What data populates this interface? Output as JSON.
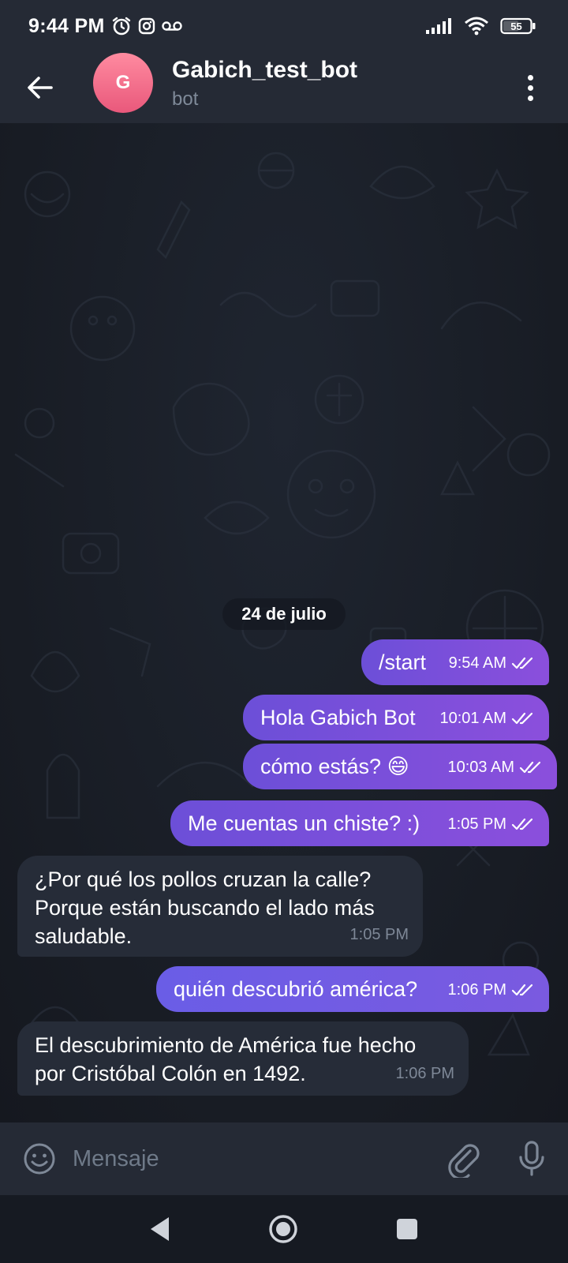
{
  "status_bar": {
    "time": "9:44 PM",
    "battery": "55",
    "icons": [
      "alarm-icon",
      "instagram-icon",
      "voicemail-icon",
      "signal-icon",
      "wifi-icon",
      "battery-icon"
    ]
  },
  "header": {
    "avatar_letter": "G",
    "title": "Gabich_test_bot",
    "subtitle": "bot",
    "back_icon": "arrow-left-icon",
    "menu_icon": "more-vertical-icon",
    "avatar_color": "#ef6a8a"
  },
  "chat": {
    "date_label": "24 de julio",
    "messages": [
      {
        "direction": "out",
        "text": "/start",
        "time": "9:54 AM"
      },
      {
        "direction": "out",
        "text": "Hola Gabich Bot",
        "time": "10:01 AM"
      },
      {
        "direction": "out",
        "text": "cómo estás? 😄",
        "time": "10:03 AM"
      },
      {
        "direction": "out",
        "text": "Me cuentas un chiste? :)",
        "time": "1:05 PM"
      },
      {
        "direction": "in",
        "lines": [
          "¿Por qué los pollos cruzan la calle?",
          "Porque están buscando el lado más",
          "saludable."
        ],
        "time": "1:05 PM"
      },
      {
        "direction": "out",
        "text": "quién descubrió américa?",
        "time": "1:06 PM"
      },
      {
        "direction": "in",
        "lines": [
          "El descubrimiento de América fue hecho",
          "por Cristóbal Colón en 1492."
        ],
        "time": "1:06 PM"
      }
    ]
  },
  "input": {
    "placeholder": "Mensaje",
    "value": ""
  },
  "colors": {
    "outgoing_bubble": "#7b4fdc",
    "incoming_bubble": "#262c38",
    "header_bg": "#252a35",
    "chat_bg": "#1a1e27"
  }
}
